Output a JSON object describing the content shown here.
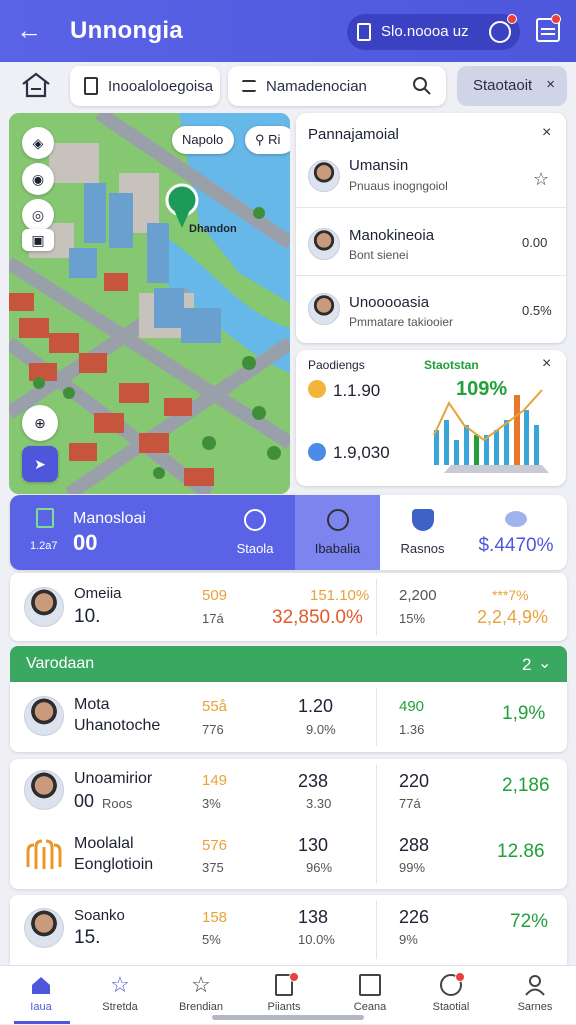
{
  "app": {
    "title": "Unnongia"
  },
  "header": {
    "pill_text": "Slo.noooa uz",
    "accent": "#5a63e6"
  },
  "search": {
    "field1": "Inooaloloegoisa",
    "field2": "Namadenocian",
    "chip": "Staotaoit"
  },
  "map": {
    "label1": "Napolo",
    "label2": "Ri",
    "pin_label": "Dhandon"
  },
  "people_panel": {
    "title": "Pannajamoial",
    "items": [
      {
        "name": "Umansin",
        "sub": "Pnuaus inogngoiol",
        "value": ""
      },
      {
        "name": "Manokineoia",
        "sub": "Bont sienei",
        "value": "0.00"
      },
      {
        "name": "Unooooasia",
        "sub": "Pmmatare takiooier",
        "value": "0.5%"
      }
    ]
  },
  "stats_panel": {
    "title": "Paodiengs",
    "subtitle": "Staotstan",
    "percent": "109%",
    "v1": "1.1.90",
    "v2": "1.9,030"
  },
  "tabs": {
    "t1_title": "Manosloai",
    "t1_num": "00",
    "t1_sub": "1.2a7",
    "t2": "Staola",
    "t3": "Ibabalia",
    "t4": "Rasnos",
    "t5": "$.4470%"
  },
  "rows": [
    {
      "name": "Omeiia",
      "num": "10.",
      "a": "509",
      "a2": "17á",
      "b": "151.10%",
      "b2": "32,850.0%",
      "c": "2,200",
      "c2": "15%",
      "d": "2,2,4,9%",
      "d_top": "***7%"
    },
    {
      "name": "Mota",
      "name2": "Uhanotoche",
      "a": "55å",
      "a2": "776",
      "b": "1.20",
      "b2": "9.0%",
      "c": "490",
      "c2": "1.36",
      "d": "1,9%"
    },
    {
      "name": "Unoamirior",
      "num": "00",
      "sub": "Roos",
      "a": "149",
      "a2": "3%",
      "b": "238",
      "b2": "3.30",
      "c": "220",
      "c2": "77á",
      "d": "2,186"
    },
    {
      "name": "Moolalal",
      "name2": "Eonglotioin",
      "a": "576",
      "a2": "375",
      "b": "130",
      "b2": "96%",
      "c": "288",
      "c2": "99%",
      "d": "12.86"
    },
    {
      "name": "Soanko",
      "num": "15.",
      "a": "158",
      "a2": "5%",
      "b": "138",
      "b2": "10.0%",
      "c": "226",
      "c2": "9%",
      "d": "72%"
    }
  ],
  "green_bar": {
    "label": "Varodaan",
    "count": "2"
  },
  "nav": [
    {
      "label": "Iaua",
      "icon": "home-icon"
    },
    {
      "label": "Stretda",
      "icon": "star-icon"
    },
    {
      "label": "Brendian",
      "icon": "star-outline-icon"
    },
    {
      "label": "Piiants",
      "icon": "document-icon"
    },
    {
      "label": "Ceana",
      "icon": "list-icon"
    },
    {
      "label": "Staotial",
      "icon": "group-icon"
    },
    {
      "label": "Sarnes",
      "icon": "profile-icon"
    }
  ]
}
